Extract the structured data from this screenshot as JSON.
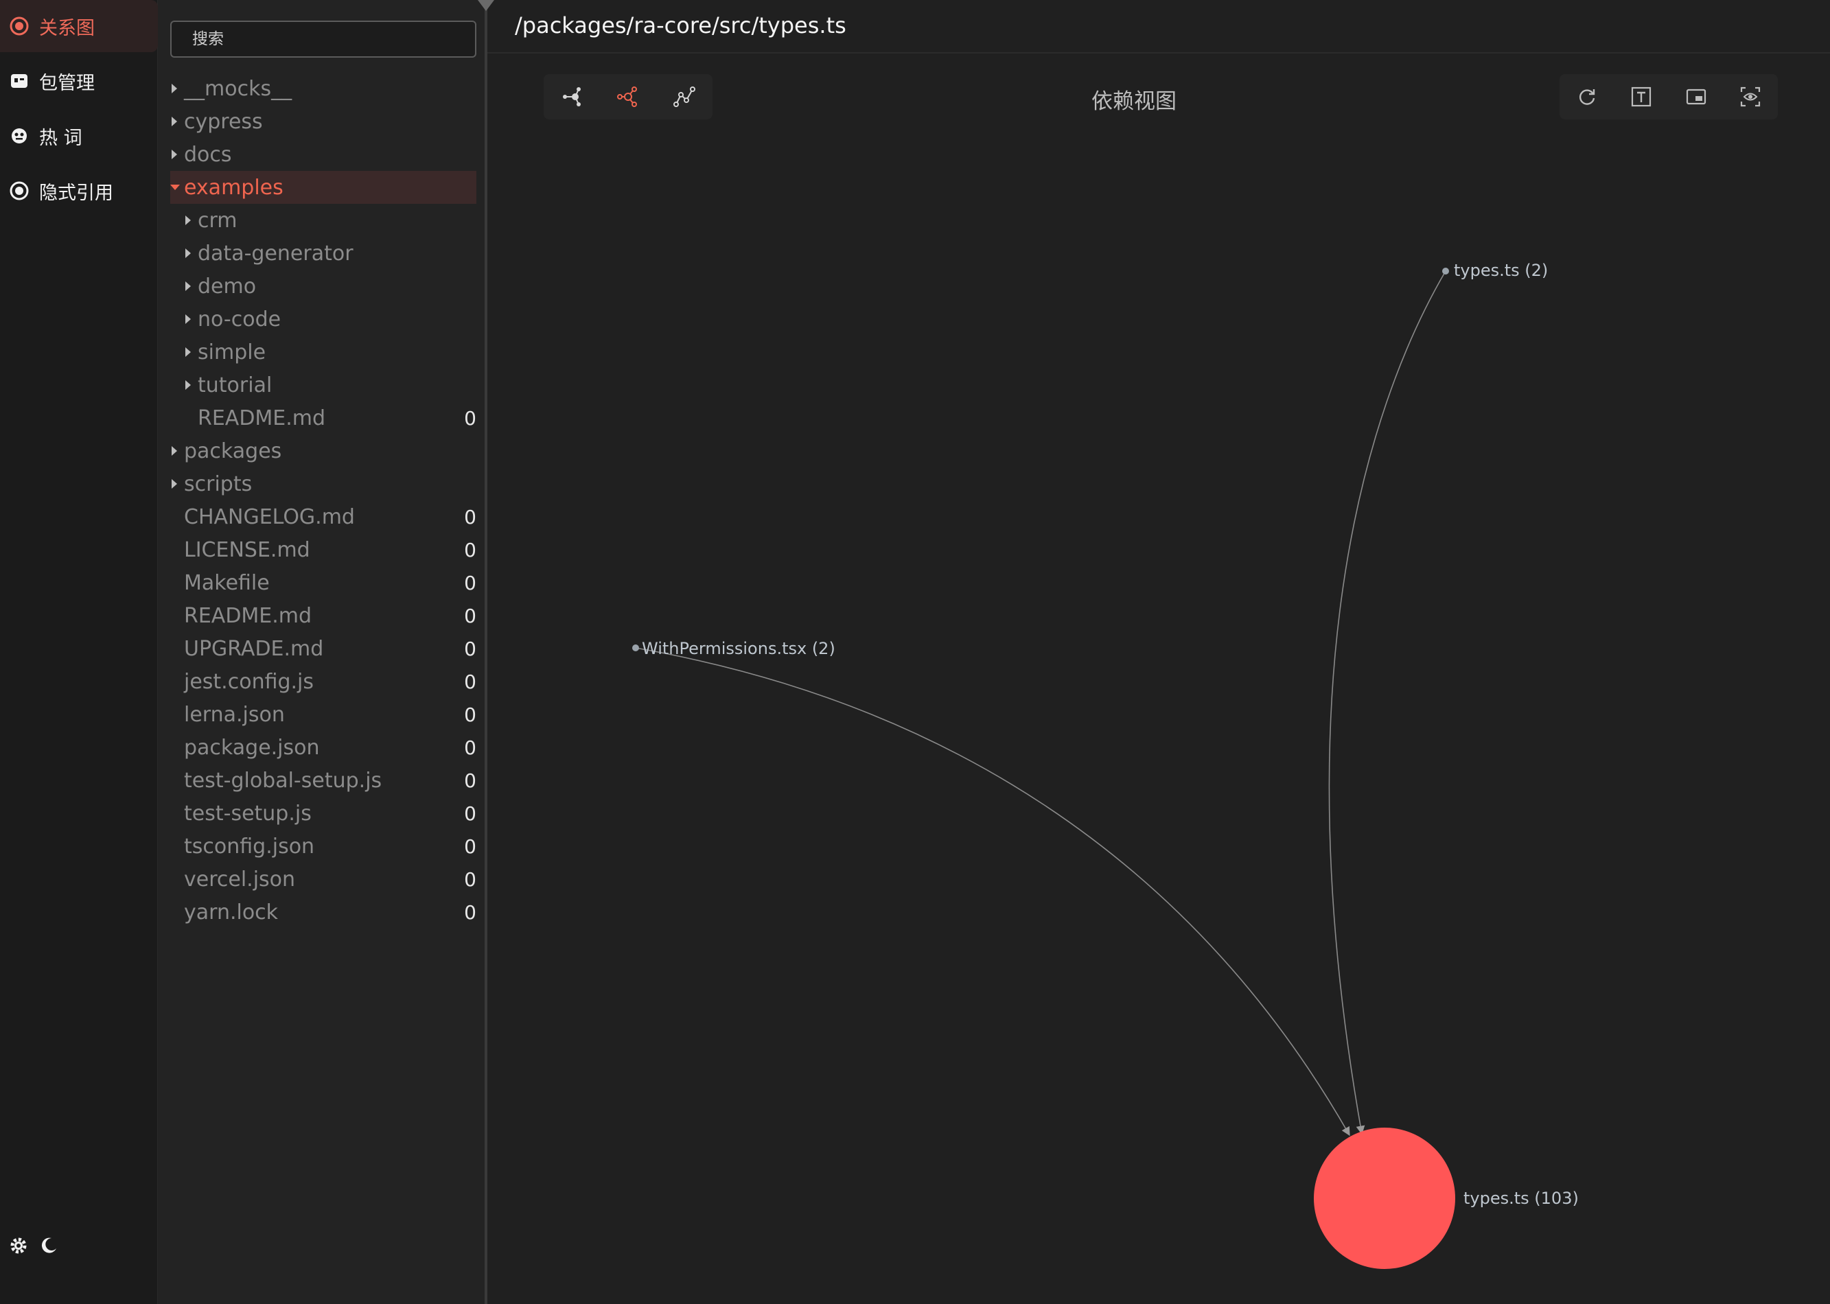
{
  "nav": {
    "items": [
      {
        "label": "关系图",
        "icon": "graph-icon",
        "active": true
      },
      {
        "label": "包管理",
        "icon": "package-icon",
        "active": false
      },
      {
        "label": "热 词",
        "icon": "hot-word-icon",
        "active": false
      },
      {
        "label": "隐式引用",
        "icon": "implicit-reference-icon",
        "active": false
      }
    ],
    "bottom": [
      "settings-icon",
      "dark-mode-icon"
    ]
  },
  "tree": {
    "search_placeholder": "搜索",
    "rows": [
      {
        "label": "__mocks__",
        "folder": true,
        "depth": 0
      },
      {
        "label": "cypress",
        "folder": true,
        "depth": 0
      },
      {
        "label": "docs",
        "folder": true,
        "depth": 0
      },
      {
        "label": "examples",
        "folder": true,
        "depth": 0,
        "expanded": true,
        "selected": true
      },
      {
        "label": "crm",
        "folder": true,
        "depth": 1
      },
      {
        "label": "data-generator",
        "folder": true,
        "depth": 1
      },
      {
        "label": "demo",
        "folder": true,
        "depth": 1
      },
      {
        "label": "no-code",
        "folder": true,
        "depth": 1
      },
      {
        "label": "simple",
        "folder": true,
        "depth": 1
      },
      {
        "label": "tutorial",
        "folder": true,
        "depth": 1
      },
      {
        "label": "README.md",
        "folder": false,
        "depth": 1,
        "count": "0"
      },
      {
        "label": "packages",
        "folder": true,
        "depth": 0
      },
      {
        "label": "scripts",
        "folder": true,
        "depth": 0
      },
      {
        "label": "CHANGELOG.md",
        "folder": false,
        "depth": 0,
        "count": "0"
      },
      {
        "label": "LICENSE.md",
        "folder": false,
        "depth": 0,
        "count": "0"
      },
      {
        "label": "Makefile",
        "folder": false,
        "depth": 0,
        "count": "0"
      },
      {
        "label": "README.md",
        "folder": false,
        "depth": 0,
        "count": "0"
      },
      {
        "label": "UPGRADE.md",
        "folder": false,
        "depth": 0,
        "count": "0"
      },
      {
        "label": "jest.config.js",
        "folder": false,
        "depth": 0,
        "count": "0"
      },
      {
        "label": "lerna.json",
        "folder": false,
        "depth": 0,
        "count": "0"
      },
      {
        "label": "package.json",
        "folder": false,
        "depth": 0,
        "count": "0"
      },
      {
        "label": "test-global-setup.js",
        "folder": false,
        "depth": 0,
        "count": "0"
      },
      {
        "label": "test-setup.js",
        "folder": false,
        "depth": 0,
        "count": "0"
      },
      {
        "label": "tsconfig.json",
        "folder": false,
        "depth": 0,
        "count": "0"
      },
      {
        "label": "vercel.json",
        "folder": false,
        "depth": 0,
        "count": "0"
      },
      {
        "label": "yarn.lock",
        "folder": false,
        "depth": 0,
        "count": "0"
      }
    ]
  },
  "main": {
    "path": "/packages/ra-core/src/types.ts",
    "view_title": "依赖视图",
    "toolbar_left": [
      "dependency-graph-icon",
      "reverse-dependency-icon",
      "path-graph-icon"
    ],
    "toolbar_right": [
      "refresh-icon",
      "text-label-icon",
      "minimap-icon",
      "focus-eye-icon"
    ],
    "active_left": 1,
    "colors": {
      "accent": "#f0654f",
      "center_node": "#ff5656",
      "edge": "#8a8a8a",
      "small_node": "#9aa3ab"
    }
  },
  "graph": {
    "nodes": [
      {
        "id": "center",
        "label": "types.ts (103)"
      },
      {
        "id": "n1",
        "label": "types.ts (2)"
      },
      {
        "id": "n2",
        "label": "WithPermissions.tsx (2)"
      }
    ],
    "edges": [
      {
        "from": "n1",
        "to": "center"
      },
      {
        "from": "n2",
        "to": "center"
      }
    ]
  }
}
